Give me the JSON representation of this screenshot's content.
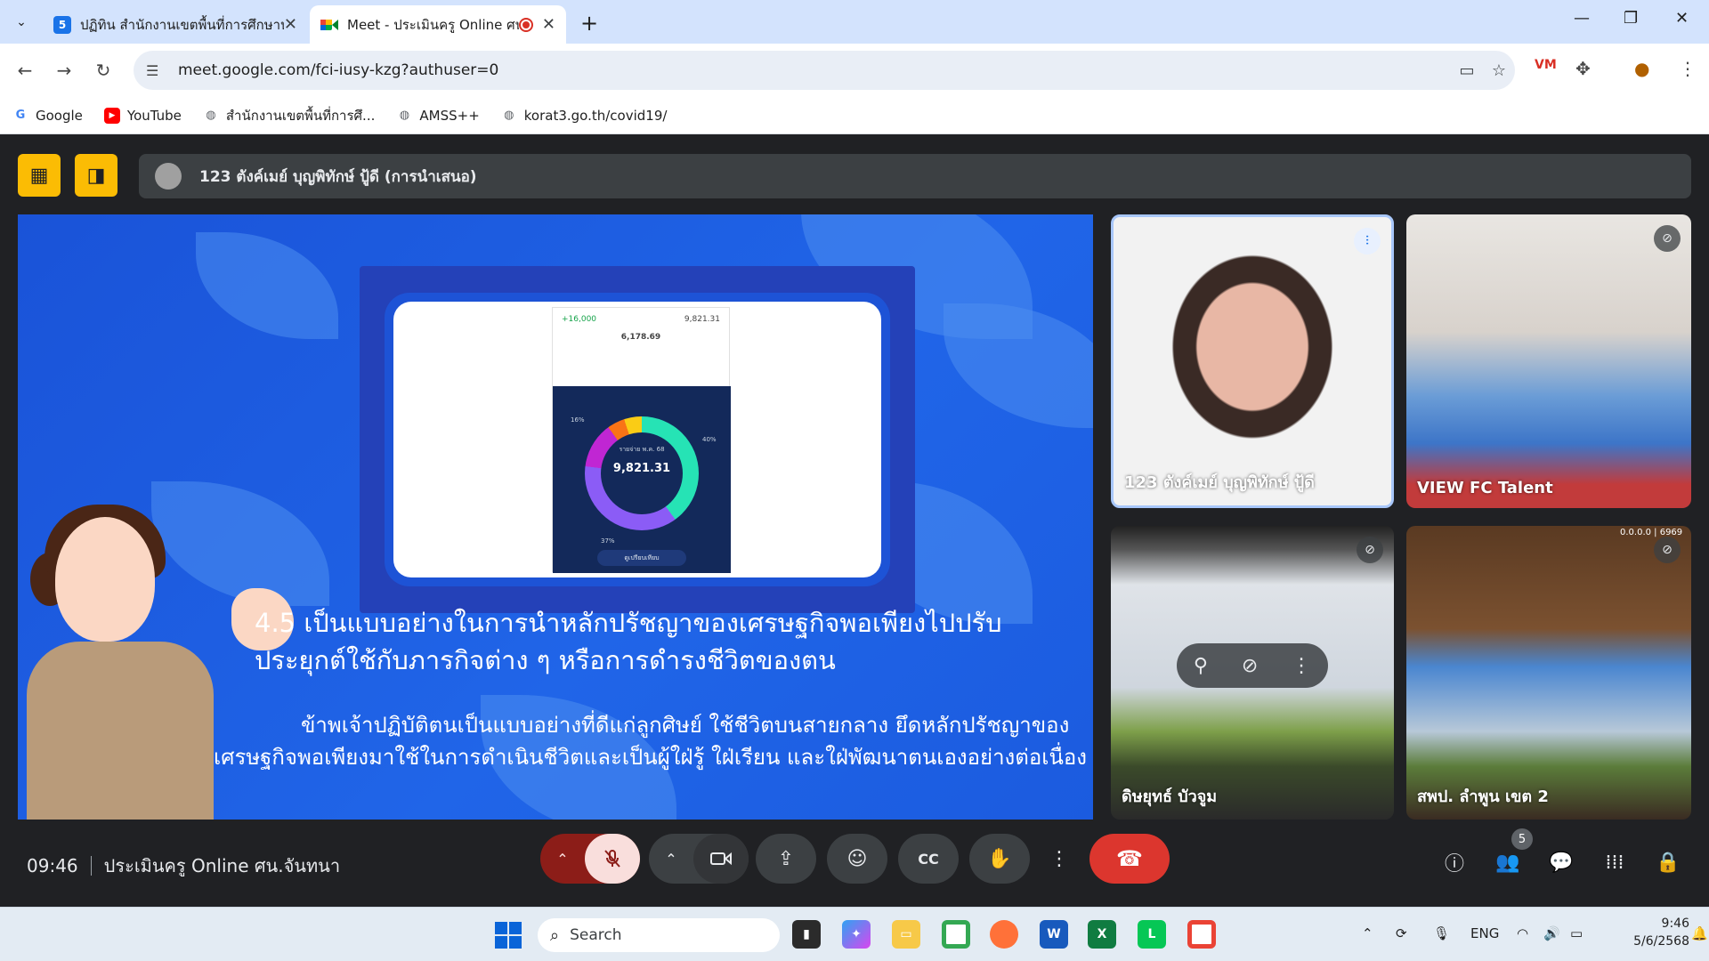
{
  "browser": {
    "tabs": [
      {
        "title": "ปฏิทิน สำนักงานเขตพื้นที่การศึกษาป",
        "favicon": "5",
        "active": false
      },
      {
        "title": "Meet - ประเมินครู Online ศน.",
        "favicon": "meet",
        "active": true
      }
    ],
    "url": "meet.google.com/fci-iusy-kzg?authuser=0",
    "bookmarks": [
      {
        "label": "Google",
        "icon": "G"
      },
      {
        "label": "YouTube",
        "icon": "youtube"
      },
      {
        "label": "สำนักงานเขตพื้นที่การศึ...",
        "icon": "globe"
      },
      {
        "label": "AMSS++",
        "icon": "globe"
      },
      {
        "label": "korat3.go.th/covid19/",
        "icon": "globe"
      }
    ]
  },
  "meet": {
    "presenter_label": "123 ตังค์เมย์ บุญพิทักษ์ ปู้ดี (การนำเสนอ)",
    "slide": {
      "heading": "4.5 เป็นแบบอย่างในการนำหลักปรัชญาของเศรษฐกิจพอเพียงไปปรับประยุกต์ใช้กับภารกิจต่าง ๆ หรือการดำรงชีวิตของตน",
      "paragraph": "ข้าพเจ้าปฏิบัติตนเป็นแบบอย่างที่ดีแก่ลูกศิษย์ ใช้ชีวิตบนสายกลาง ยึดหลักปรัชญาของเศรษฐกิจพอเพียงมาใช้ในการดำเนินชีวิตและเป็นผู้ใฝ่รู้ ใฝ่เรียน และใฝ่พัฒนาตนเองอย่างต่อเนื่อง",
      "phone_income": "+16,000",
      "phone_balance_top": "9,821.31",
      "phone_total": "6,178.69",
      "donut_label": "รายจ่าย",
      "donut_sub": "พ.ค. 68",
      "donut_value": "9,821.31",
      "pct_left": "16%",
      "pct_right": "40%",
      "pct_bottom": "37%",
      "phone_button": "ดูเปรียบเทียบ"
    },
    "participants": [
      {
        "name": "123 ตังค์เมย์ บุญพิทักษ์ ปู้ดี",
        "speaking": true
      },
      {
        "name": "VIEW FC Talent",
        "muted": true
      },
      {
        "name": "ดิษยุทธ์ บัวจูม",
        "muted": true
      },
      {
        "name": "สพป. ลำพูน เขต 2",
        "muted": true
      }
    ],
    "tile4_overlay": "0.0.0.0 | 6969",
    "time": "09:46",
    "meeting_title": "ประเมินครู Online ศน.จันทนา",
    "participant_count": "5"
  },
  "taskbar": {
    "search_placeholder": "Search",
    "lang": "ENG",
    "clock_time": "9:46",
    "clock_date": "5/6/2568"
  },
  "colors": {
    "tab_bar": "#d3e3fd",
    "meet_bg": "#202124",
    "hangup": "#dc362e",
    "slide_blue": "#1a53d8",
    "accent_yellow": "#fbbc04"
  }
}
